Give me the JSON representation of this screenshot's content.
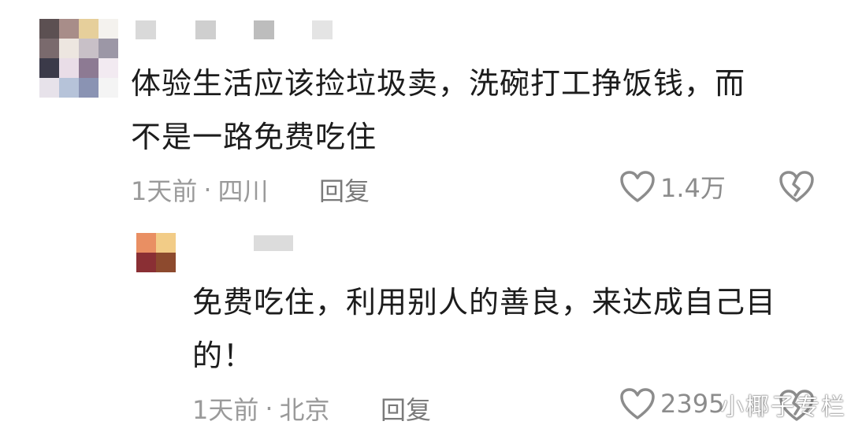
{
  "comment": {
    "avatar_colors": [
      "#5c5052",
      "#a88d89",
      "#e6cf9b",
      "#f4f2ee",
      "#7a6a6d",
      "#ede6e0",
      "#c8c0c7",
      "#9c97a6",
      "#3b3a49",
      "#e9dde7",
      "#8d7a93",
      "#f2eaf1",
      "#e7e2ea",
      "#b6c3d9",
      "#8a93b3",
      "#f4f4f4"
    ],
    "name_blocks": [
      "#d9d9d9",
      "#cfcfcf",
      "#bdbdbd",
      "#e4e4e4"
    ],
    "text_line1": "体验生活应该捡垃圾卖，洗碗打工挣饭钱，而",
    "text_line2": "不是一路免费吃住",
    "time": "1天前",
    "location": "四川",
    "reply_label": "回复",
    "likes": "1.4万"
  },
  "reply": {
    "avatar_colors": [
      "#e98f63",
      "#f2cc87",
      "#8a2f34",
      "#8d4a2e"
    ],
    "name_block": "#dcdcdc",
    "text_line1": "免费吃住，利用别人的善良，来达成自己目",
    "text_line2": "的！",
    "time": "1天前",
    "location": "北京",
    "reply_label": "回复",
    "likes": "2395"
  },
  "meta_separator": "·",
  "watermark": "小椰子专栏",
  "icons": {
    "like": "heart-outline-icon",
    "dislike": "broken-heart-icon"
  }
}
